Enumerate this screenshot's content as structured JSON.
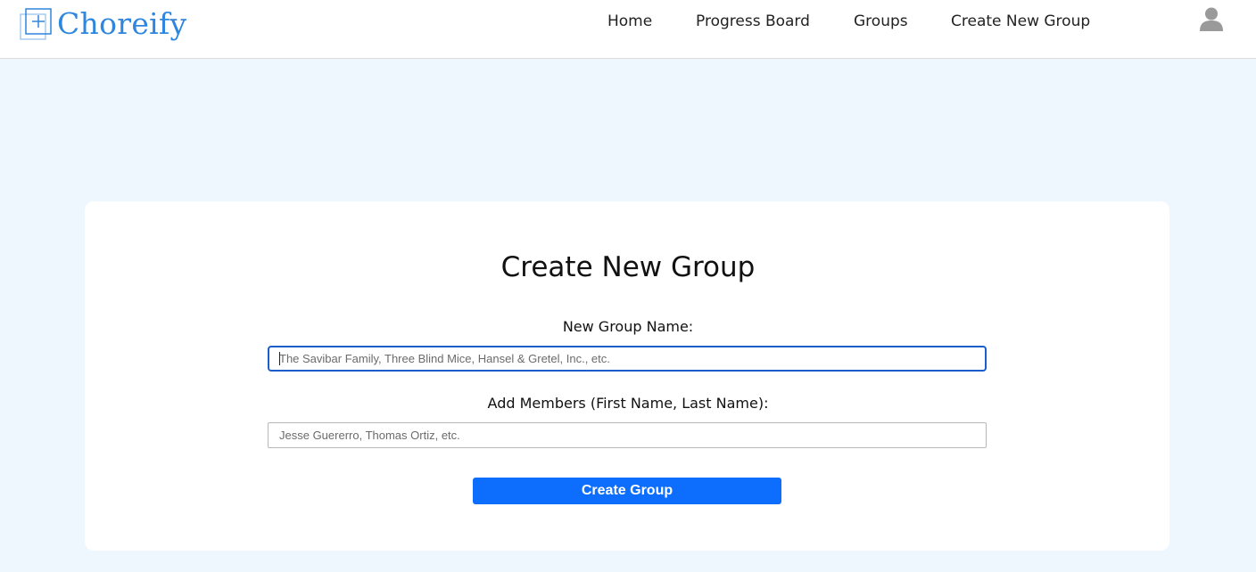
{
  "nav": {
    "brand_name": "Choreify",
    "links": [
      {
        "label": "Home"
      },
      {
        "label": "Progress Board"
      },
      {
        "label": "Groups"
      },
      {
        "label": "Create New Group"
      }
    ]
  },
  "form": {
    "title": "Create New Group",
    "group_name_label": "New Group Name:",
    "group_name_placeholder": "The Savibar Family, Three Blind Mice, Hansel & Gretel, Inc., etc.",
    "group_name_value": "",
    "members_label": "Add Members (First Name, Last Name):",
    "members_placeholder": "Jesse Guererro, Thomas Ortiz, etc.",
    "members_value": "",
    "submit_label": "Create Group"
  },
  "colors": {
    "brand": "#2e86de",
    "page_background": "#eef6fe",
    "button": "#0d6efd",
    "focus_border": "#1a5fc9"
  },
  "icons": {
    "brand": "plus-square-icon",
    "account": "user-icon"
  }
}
